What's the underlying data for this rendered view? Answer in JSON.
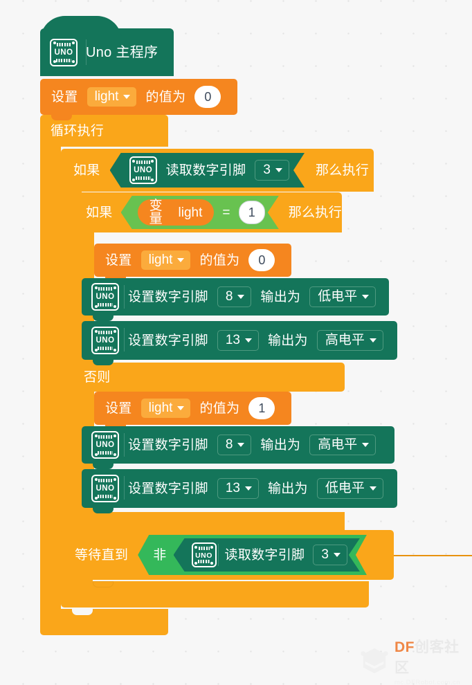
{
  "workspace": {
    "background_color": "#f7f7f7",
    "grid_dot_color": "#e3e3e3"
  },
  "palette": {
    "hat_green": "#14755a",
    "uno_block_green": "#14755a",
    "control_orange": "#faa61a",
    "variable_orange": "#f5861f",
    "compare_green": "#68c250",
    "logic_green": "#34b85a",
    "field_orange": "#fbab3c",
    "text_white": "#ffffff",
    "number_text": "#3d4a5c"
  },
  "blocks": {
    "hat": {
      "icon": "uno-board-icon",
      "label": "Uno 主程序"
    },
    "set_light_0": {
      "prefix": "设置",
      "variable": "light",
      "suffix": "的值为",
      "value": "0",
      "dropdown_icon": "chevron-down-icon"
    },
    "forever": {
      "label": "循环执行"
    },
    "if_outer": {
      "prefix": "如果",
      "suffix": "那么执行",
      "condition": {
        "icon": "uno-board-icon",
        "label": "读取数字引脚",
        "pin": "3",
        "dropdown_icon": "chevron-down-icon"
      }
    },
    "if_inner": {
      "prefix": "如果",
      "suffix": "那么执行",
      "else_label": "否则",
      "condition": {
        "variable_prefix": "变量",
        "variable": "light",
        "operator": "=",
        "value": "1"
      }
    },
    "then_branch": {
      "set_var": {
        "prefix": "设置",
        "variable": "light",
        "suffix": "的值为",
        "value": "0"
      },
      "pin_writes": [
        {
          "icon": "uno-board-icon",
          "label": "设置数字引脚",
          "pin": "8",
          "mid": "输出为",
          "level": "低电平"
        },
        {
          "icon": "uno-board-icon",
          "label": "设置数字引脚",
          "pin": "13",
          "mid": "输出为",
          "level": "高电平"
        }
      ]
    },
    "else_branch": {
      "set_var": {
        "prefix": "设置",
        "variable": "light",
        "suffix": "的值为",
        "value": "1"
      },
      "pin_writes": [
        {
          "icon": "uno-board-icon",
          "label": "设置数字引脚",
          "pin": "8",
          "mid": "输出为",
          "level": "高电平"
        },
        {
          "icon": "uno-board-icon",
          "label": "设置数字引脚",
          "pin": "13",
          "mid": "输出为",
          "level": "低电平"
        }
      ]
    },
    "wait_until": {
      "label": "等待直到",
      "not_label": "非",
      "condition": {
        "icon": "uno-board-icon",
        "label": "读取数字引脚",
        "pin": "3",
        "dropdown_icon": "chevron-down-icon"
      }
    }
  },
  "watermark": {
    "brand_df": "DF",
    "brand_cn": "创客社区",
    "url": "mc.DFRobot.com.cn",
    "logo_icon": "shield-logo-icon"
  }
}
